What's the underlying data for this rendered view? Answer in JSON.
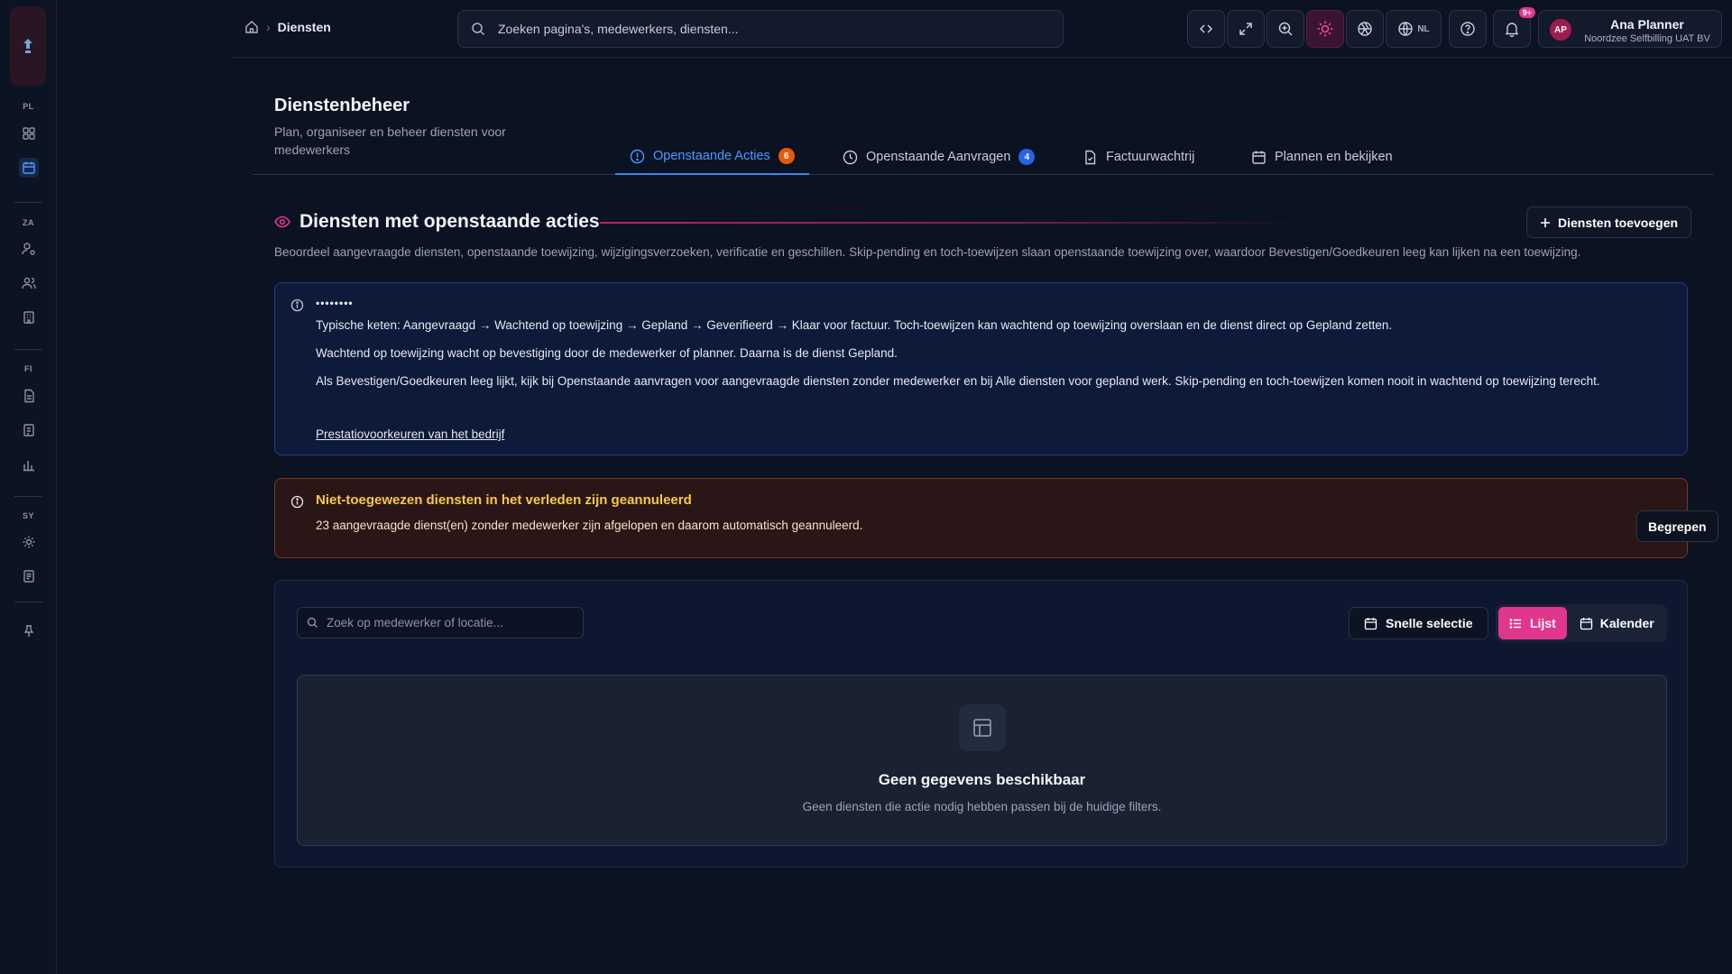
{
  "breadcrumb": {
    "current": "Diensten"
  },
  "search": {
    "placeholder": "Zoeken pagina's, medewerkers, diensten..."
  },
  "header": {
    "lang": "NL",
    "notif_badge": "9+",
    "user": {
      "initials": "AP",
      "name": "Ana Planner",
      "org": "Noordzee Selfbilling UAT BV"
    }
  },
  "sidebar": {
    "sections": [
      "PL",
      "ZA",
      "FI",
      "SY"
    ]
  },
  "page": {
    "title": "Dienstenbeheer",
    "subtitle": "Plan, organiseer en beheer diensten voor medewerkers"
  },
  "tabs": [
    {
      "label": "Openstaande Acties",
      "badge": "6",
      "active": true
    },
    {
      "label": "Openstaande Aanvragen",
      "badge": "4",
      "active": false
    },
    {
      "label": "Factuurwachtrij",
      "active": false
    },
    {
      "label": "Plannen en bekijken",
      "active": false
    }
  ],
  "section": {
    "title": "Diensten met openstaande acties",
    "add_button": "Diensten toevoegen",
    "description": "Beoordeel aangevraagde diensten, openstaande toewijzing, wijzigingsverzoeken, verificatie en geschillen. Skip-pending en toch-toewijzen slaan openstaande toewijzing over, waardoor Bevestigen/Goedkeuren leeg kan lijken na een toewijzing."
  },
  "info": {
    "title": "••••••••",
    "p1": "Typische keten: Aangevraagd → Wachtend op toewijzing → Gepland → Geverifieerd → Klaar voor factuur. Toch-toewijzen kan wachtend op toewijzing overslaan en de dienst direct op Gepland zetten.",
    "p2": "Wachtend op toewijzing wacht op bevestiging door de medewerker of planner. Daarna is de dienst Gepland.",
    "p3": "Als Bevestigen/Goedkeuren leeg lijkt, kijk bij Openstaande aanvragen voor aangevraagde diensten zonder medewerker en bij Alle diensten voor gepland werk. Skip-pending en toch-toewijzen komen nooit in wachtend op toewijzing terecht.",
    "link": "Prestatiovoorkeuren van het bedrijf"
  },
  "warning": {
    "title": "Niet-toegewezen diensten in het verleden zijn geannuleerd",
    "text": "23 aangevraagde dienst(en) zonder medewerker zijn afgelopen en daarom automatisch geannuleerd.",
    "button": "Begrepen"
  },
  "list": {
    "search_placeholder": "Zoek op medewerker of locatie...",
    "quick_select": "Snelle selectie",
    "view_list": "Lijst",
    "view_calendar": "Kalender",
    "empty_title": "Geen gegevens beschikbaar",
    "empty_sub": "Geen diensten die actie nodig hebben passen bij de huidige filters."
  },
  "colors": {
    "accent": "#e0368d",
    "tab_active": "#3b82f6",
    "warning": "#f7c948",
    "badge_orange": "#ea580c",
    "badge_blue": "#2563eb"
  }
}
